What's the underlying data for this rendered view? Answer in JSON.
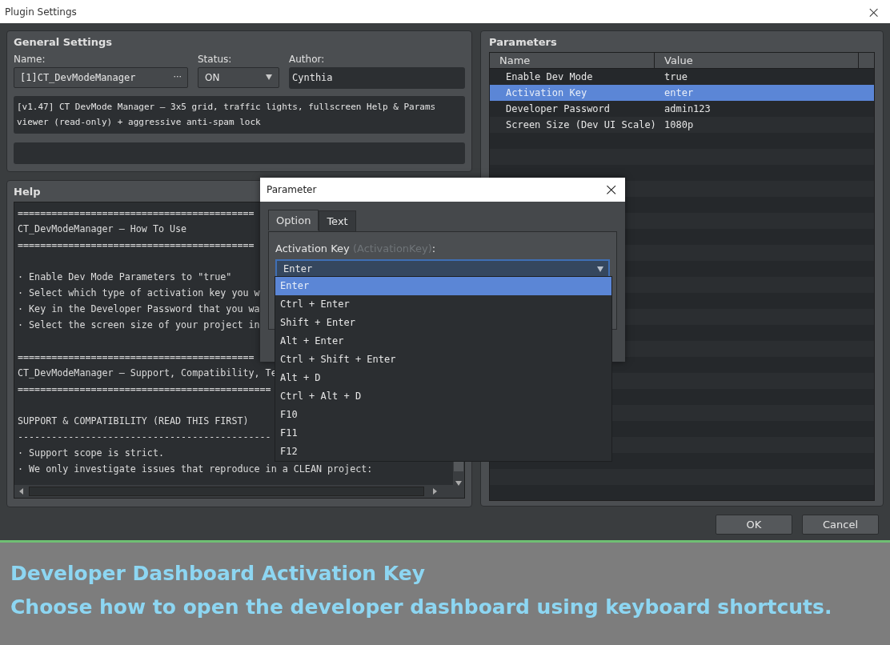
{
  "window": {
    "title": "Plugin Settings",
    "close": "×"
  },
  "general": {
    "heading": "General Settings",
    "name_label": "Name:",
    "name_value": "[1]CT_DevModeManager",
    "name_more": "···",
    "status_label": "Status:",
    "status_value": "ON",
    "author_label": "Author:",
    "author_value": "Cynthia",
    "description": "[v1.47] CT DevMode Manager — 3x5 grid, traffic lights, fullscreen Help & Params viewer (read-only) + aggressive anti-spam lock"
  },
  "help": {
    "heading": "Help",
    "blocks": [
      [
        "==========================================",
        "CT_DevModeManager — How To Use",
        "=========================================="
      ],
      [
        "· Enable Dev Mode Parameters to \"true\"",
        "· Select which type of activation key you w",
        "· Key in the Developer Password that you wa",
        "· Select the screen size of your project in"
      ],
      [
        "==========================================",
        "CT_DevModeManager — Support, Compatibility, Te",
        "============================================="
      ],
      [
        "SUPPORT & COMPATIBILITY (READ THIS FIRST)",
        "---------------------------------------------",
        "· Support scope is strict.",
        "· We only investigate issues that reproduce in a CLEAN project:"
      ]
    ]
  },
  "parameters": {
    "heading": "Parameters",
    "columns": [
      "Name",
      "Value"
    ],
    "rows": [
      {
        "name": "Enable Dev Mode",
        "value": "true",
        "selected": false
      },
      {
        "name": "Activation Key",
        "value": "enter",
        "selected": true
      },
      {
        "name": "Developer Password",
        "value": "admin123",
        "selected": false
      },
      {
        "name": "Screen Size (Dev UI Scale)",
        "value": "1080p",
        "selected": false
      }
    ]
  },
  "dialog": {
    "title": "Parameter",
    "close": "×",
    "tabs": [
      {
        "label": "Option",
        "selected": true
      },
      {
        "label": "Text",
        "selected": false
      }
    ],
    "field_label": "Activation Key",
    "field_key": "(ActivationKey)",
    "field_colon": ":",
    "value": "Enter",
    "options": [
      {
        "label": "Enter",
        "selected": true
      },
      {
        "label": "Ctrl + Enter",
        "selected": false
      },
      {
        "label": "Shift + Enter",
        "selected": false
      },
      {
        "label": "Alt + Enter",
        "selected": false
      },
      {
        "label": "Ctrl + Shift + Enter",
        "selected": false
      },
      {
        "label": "Alt + D",
        "selected": false
      },
      {
        "label": "Ctrl + Alt + D",
        "selected": false
      },
      {
        "label": "F10",
        "selected": false
      },
      {
        "label": "F11",
        "selected": false
      },
      {
        "label": "F12",
        "selected": false
      }
    ]
  },
  "buttons": [
    "OK",
    "Cancel"
  ],
  "caption": [
    "Developer Dashboard Activation Key",
    "Choose how to open the developer dashboard using keyboard shortcuts."
  ]
}
